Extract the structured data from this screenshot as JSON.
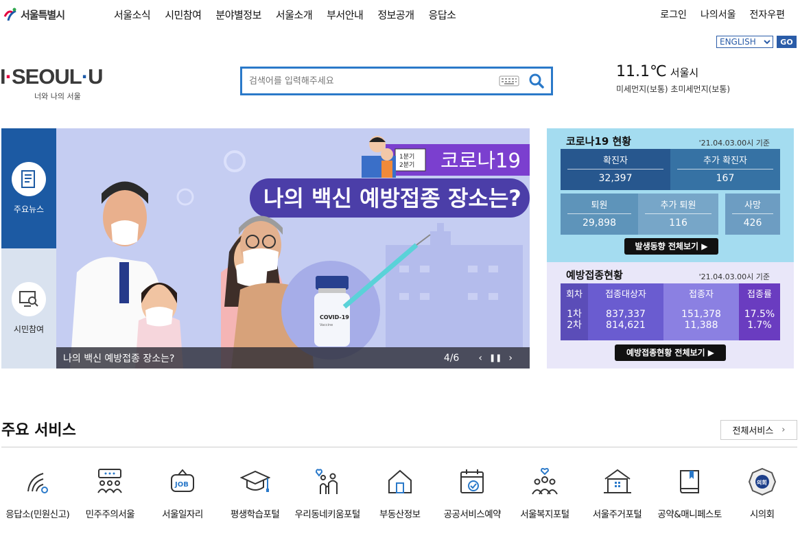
{
  "header": {
    "logo_text": "서울특별시",
    "gnb": [
      "서울소식",
      "시민참여",
      "분야별정보",
      "서울소개",
      "부서안내",
      "정보공개",
      "응답소"
    ],
    "util": [
      "로그인",
      "나의서울",
      "전자우편"
    ],
    "lang_selected": "ENGLISH",
    "go_label": "GO"
  },
  "slogan": {
    "i": "I",
    "seoul": "SEOUL",
    "u": "U",
    "sub": "너와 나의 서울"
  },
  "search": {
    "placeholder": "검색어를 입력해주세요"
  },
  "weather": {
    "temp": "11.1℃",
    "city": "서울시",
    "dust": "미세먼지(보통) 초미세먼지(보통)"
  },
  "side_tabs": [
    "주요뉴스",
    "시민참여"
  ],
  "banner": {
    "tag": "코로나19",
    "headline": "나의 백신 예방접종 장소는?",
    "badge1": "1분기",
    "badge2": "2분기",
    "vial": "COVID-19",
    "vial_sub": "Vaccine",
    "caption": "나의 백신 예방접종 장소는?",
    "counter": "4/6"
  },
  "covid": {
    "title": "코로나19 현황",
    "date": "'21.04.03.00시 기준",
    "confirmed_label": "확진자",
    "confirmed": "32,397",
    "added_label": "추가 확진자",
    "added": "167",
    "released_label": "퇴원",
    "released": "29,898",
    "added_released_label": "추가 퇴원",
    "added_released": "116",
    "death_label": "사망",
    "death": "426",
    "more": "발생동향 전체보기 ▶"
  },
  "vaccine": {
    "title": "예방접종현황",
    "date": "'21.04.03.00시 기준",
    "cols": [
      "회차",
      "접종대상자",
      "접종자",
      "접종률"
    ],
    "row1": [
      "1차",
      "837,337",
      "151,378",
      "17.5%"
    ],
    "row2": [
      "2차",
      "814,621",
      "11,388",
      "1.7%"
    ],
    "more": "예방접종현황 전체보기 ▶"
  },
  "services": {
    "title": "주요 서비스",
    "all": "전체서비스",
    "items": [
      "응답소(민원신고)",
      "민주주의서울",
      "서울일자리",
      "평생학습포털",
      "우리동네키움포털",
      "부동산정보",
      "공공서비스예약",
      "서울복지포털",
      "서울주거포털",
      "공약&매니페스토",
      "시의회"
    ],
    "job_text": "JOB",
    "council_text": "의회"
  }
}
